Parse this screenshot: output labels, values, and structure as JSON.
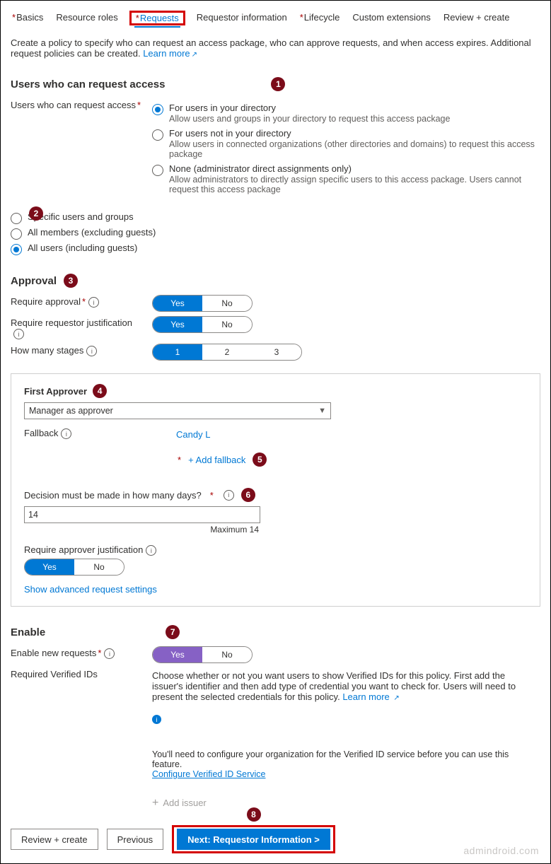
{
  "tabs": [
    {
      "label": "Basics",
      "required": true
    },
    {
      "label": "Resource roles",
      "required": false
    },
    {
      "label": "Requests",
      "required": true,
      "active": true,
      "highlight": true
    },
    {
      "label": "Requestor information",
      "required": false
    },
    {
      "label": "Lifecycle",
      "required": true
    },
    {
      "label": "Custom extensions",
      "required": false
    },
    {
      "label": "Review + create",
      "required": false
    }
  ],
  "intro": {
    "text": "Create a policy to specify who can request an access package, who can approve requests, and when access expires. Additional request policies can be created.",
    "learn_more": "Learn more"
  },
  "users_section": {
    "title": "Users who can request access",
    "label": "Users who can request access",
    "options": [
      {
        "label": "For users in your directory",
        "desc": "Allow users and groups in your directory to request this access package",
        "selected": true
      },
      {
        "label": "For users not in your directory",
        "desc": "Allow users in connected organizations (other directories and domains) to request this access package",
        "selected": false
      },
      {
        "label": "None (administrator direct assignments only)",
        "desc": "Allow administrators to directly assign specific users to this access package. Users cannot request this access package",
        "selected": false
      }
    ],
    "scope": [
      {
        "label": "Specific users and groups",
        "selected": false
      },
      {
        "label": "All members (excluding guests)",
        "selected": false
      },
      {
        "label": "All users (including guests)",
        "selected": true
      }
    ]
  },
  "approval": {
    "title": "Approval",
    "require_label": "Require approval",
    "justification_label": "Require requestor justification",
    "stages_label": "How many stages",
    "yes": "Yes",
    "no": "No",
    "stages": [
      "1",
      "2",
      "3"
    ],
    "first_approver_title": "First Approver",
    "approver_value": "Manager as approver",
    "fallback_label": "Fallback",
    "fallback_user": "Candy L",
    "add_fallback": "+ Add fallback",
    "days_label": "Decision must be made in how many days?",
    "days_value": "14",
    "days_max": "Maximum 14",
    "approver_just_label": "Require approver justification",
    "advanced": "Show advanced request settings"
  },
  "enable": {
    "title": "Enable",
    "enable_label": "Enable new requests",
    "yes": "Yes",
    "no": "No",
    "verified_label": "Required Verified IDs",
    "verified_desc": "Choose whether or not you want users to show Verified IDs for this policy. First add the issuer's identifier and then add type of credential you want to check for. Users will need to present the selected credentials for this policy.",
    "learn_more": "Learn more",
    "hint": "You'll need to configure your organization for the Verified ID service before you can use this feature.",
    "configure_link": "Configure Verified ID Service",
    "add_issuer": "Add issuer"
  },
  "footer": {
    "review": "Review + create",
    "previous": "Previous",
    "next": "Next: Requestor Information >"
  },
  "watermark": "admindroid.com"
}
